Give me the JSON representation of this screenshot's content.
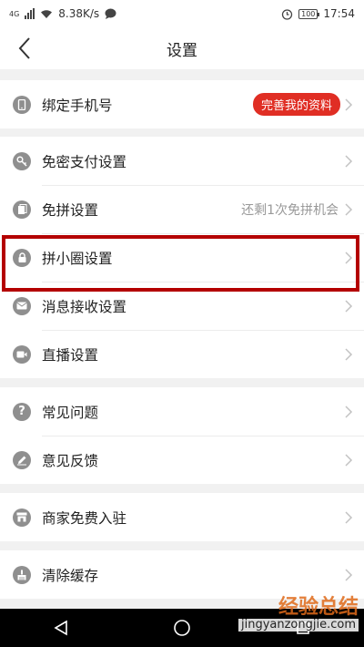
{
  "status_bar": {
    "network": "4G",
    "speed": "8.38K/s",
    "battery": "100",
    "time": "17:54"
  },
  "header": {
    "title": "设置"
  },
  "groups": [
    [
      {
        "label": "绑定手机号",
        "icon": "phone-icon",
        "badge": "完善我的资料"
      }
    ],
    [
      {
        "label": "免密支付设置",
        "icon": "key-icon"
      },
      {
        "label": "免拼设置",
        "icon": "free-group-icon",
        "value": "还剩1次免拼机会"
      },
      {
        "label": "拼小圈设置",
        "icon": "lock-icon"
      },
      {
        "label": "消息接收设置",
        "icon": "mail-icon"
      },
      {
        "label": "直播设置",
        "icon": "video-camera-icon"
      }
    ],
    [
      {
        "label": "常见问题",
        "icon": "question-icon"
      },
      {
        "label": "意见反馈",
        "icon": "pencil-icon"
      }
    ],
    [
      {
        "label": "商家免费入驻",
        "icon": "store-icon"
      }
    ],
    [
      {
        "label": "清除缓存",
        "icon": "broom-icon"
      }
    ]
  ],
  "watermark": {
    "text": "经验总结",
    "url": "jingyanzongjie.com"
  },
  "colors": {
    "accent": "#e02e24",
    "highlight": "#b40000",
    "icon": "#8f8f8f"
  }
}
